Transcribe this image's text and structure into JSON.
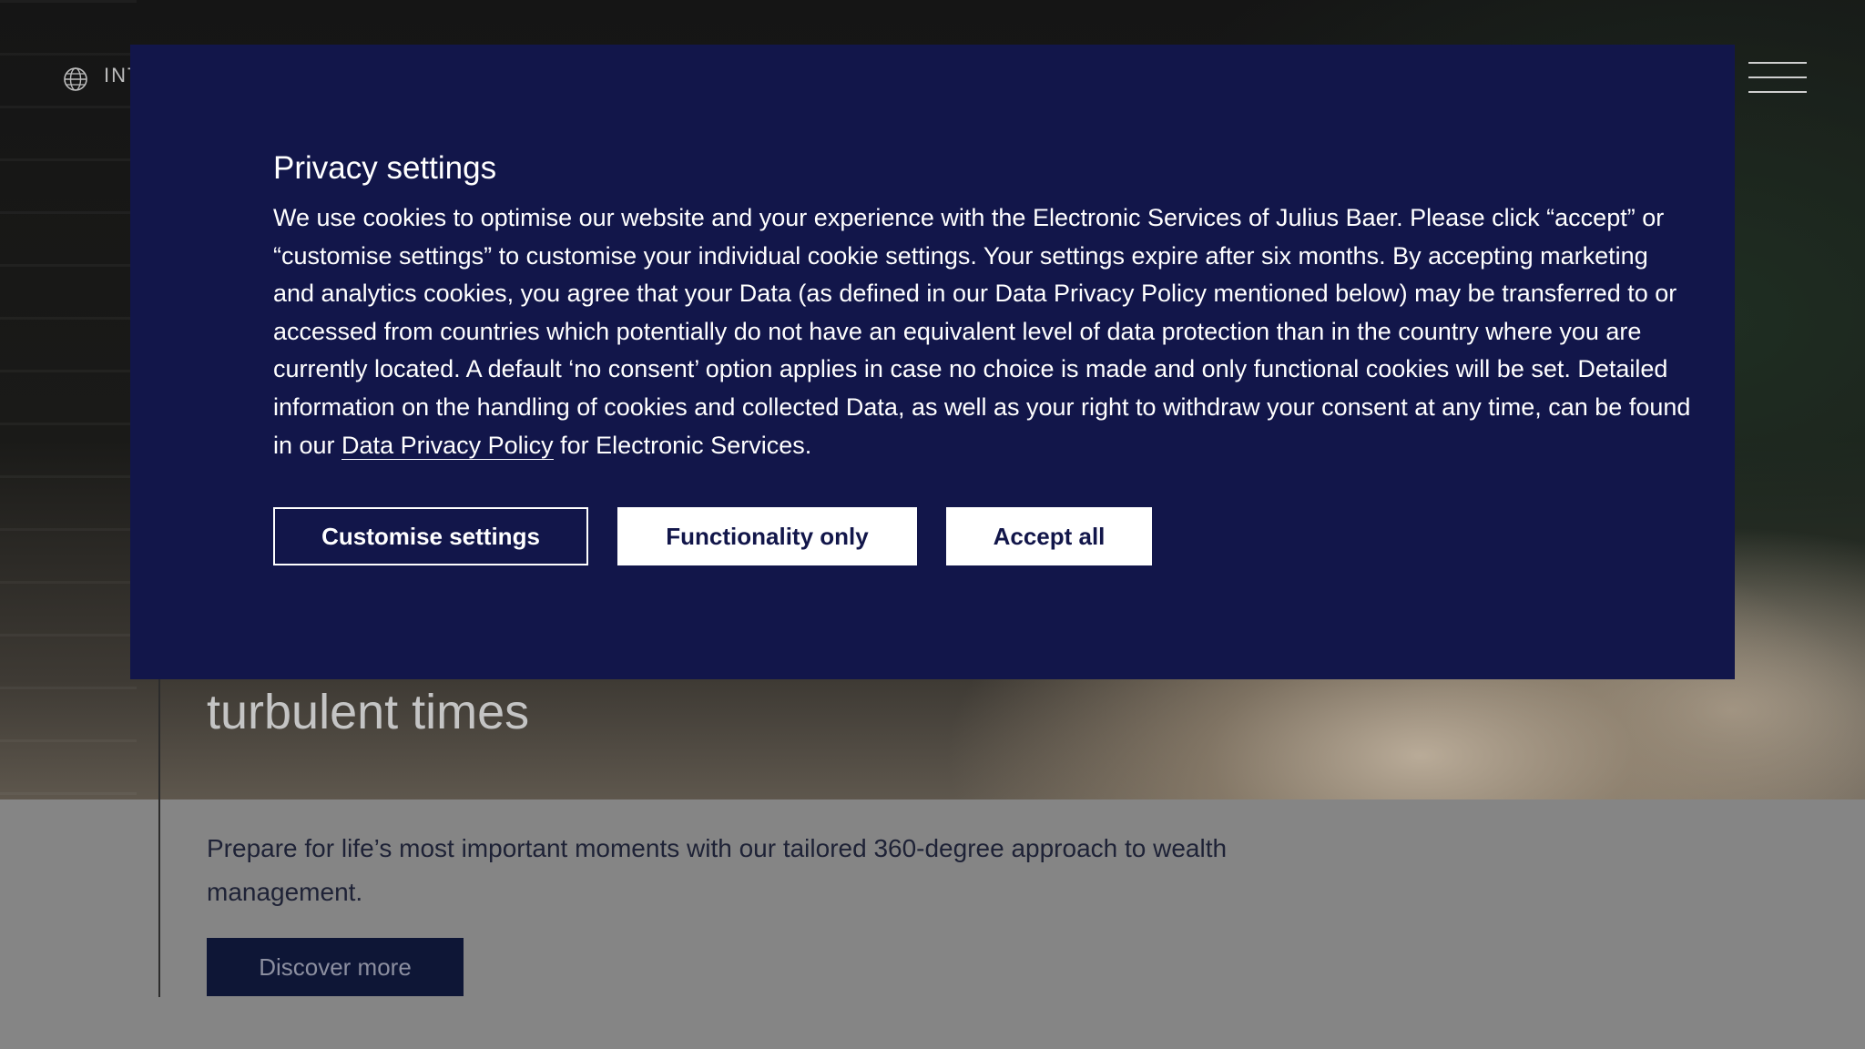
{
  "header": {
    "region_label": "INT",
    "globe_icon": "globe-icon",
    "menu_icon": "hamburger-menu-icon"
  },
  "hero": {
    "title_visible_fragment": "turbulent times",
    "description": "Prepare for life’s most important moments with our tailored 360-degree approach to wealth management.",
    "cta_label": "Discover more"
  },
  "privacy_modal": {
    "title": "Privacy settings",
    "body_before_link": "We use cookies to optimise our website and your experience with the Electronic Services of Julius Baer. Please click “accept” or “customise settings” to customise your individual cookie settings. Your settings expire after six months. By accepting marketing and analytics cookies, you agree that your Data (as defined in our Data Privacy Policy mentioned below) may be transferred to or accessed from countries which potentially do not have an equivalent level of data protection than in the country where you are currently located. A default ‘no consent’ option applies in case no choice is made and only functional cookies will be set. Detailed information on the handling of cookies and collected Data, as well as your right to withdraw your consent at any time, can be found in our ",
    "link_text": "Data Privacy Policy",
    "body_after_link": " for Electronic Services.",
    "buttons": {
      "customise": "Customise settings",
      "functionality": "Functionality only",
      "accept": "Accept all"
    }
  },
  "colors": {
    "modal_background": "#12164a",
    "button_text_dark": "#12164a",
    "cta_background": "#0e1636"
  }
}
